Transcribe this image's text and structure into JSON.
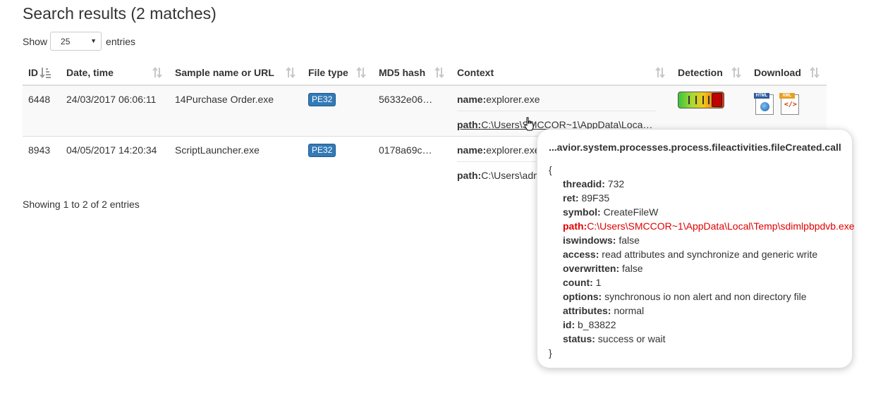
{
  "page_title": "Search results (2 matches)",
  "length": {
    "show_label": "Show",
    "selected": "25",
    "entries_label": "entries"
  },
  "table": {
    "columns": [
      "ID",
      "Date, time",
      "Sample name or URL",
      "File type",
      "MD5 hash",
      "Context",
      "Detection",
      "Download"
    ],
    "rows": [
      {
        "id": "6448",
        "datetime": "24/03/2017 06:06:11",
        "sample": "14Purchase Order.exe",
        "filetype": "PE32",
        "md5": "56332e06…",
        "ctx_name_key": "name:",
        "ctx_name_val": "explorer.exe",
        "ctx_path_key": "path:",
        "ctx_path_val": "C:\\Users\\SMCCOR~1\\AppData\\Loca…"
      },
      {
        "id": "8943",
        "datetime": "04/05/2017 14:20:34",
        "sample": "ScriptLauncher.exe",
        "filetype": "PE32",
        "md5": "0178a69c…",
        "ctx_name_key": "name:",
        "ctx_name_val": "explorer.exe",
        "ctx_path_key": "path:",
        "ctx_path_val": "C:\\Users\\adm"
      }
    ],
    "download_tags": {
      "html": "HTML",
      "xml": "XML"
    }
  },
  "info": "Showing 1 to 2 of 2 entries",
  "popover": {
    "title": "...avior.system.processes.process.fileactivities.fileCreated.call",
    "open_brace": "{",
    "close_brace": "}",
    "fields": [
      {
        "key": "threadid:",
        "value": " 732"
      },
      {
        "key": "ret:",
        "value": " 89F35"
      },
      {
        "key": "symbol:",
        "value": " CreateFileW"
      },
      {
        "key": "path:",
        "value": "C:\\Users\\SMCCOR~1\\AppData\\Local\\Temp\\sdimlpbpdvb.exe"
      },
      {
        "key": "iswindows:",
        "value": " false"
      },
      {
        "key": "access:",
        "value": " read attributes and synchronize and generic write"
      },
      {
        "key": "overwritten:",
        "value": " false"
      },
      {
        "key": "count:",
        "value": " 1"
      },
      {
        "key": "options:",
        "value": " synchronous io non alert and non directory file"
      },
      {
        "key": "attributes:",
        "value": " normal"
      },
      {
        "key": "id:",
        "value": " b_83822"
      },
      {
        "key": "status:",
        "value": " success or wait"
      }
    ],
    "highlight_color": "#e00000"
  },
  "colors": {
    "badge": "#337ab7",
    "text": "#333333",
    "stripe": "#f9f9f9"
  }
}
